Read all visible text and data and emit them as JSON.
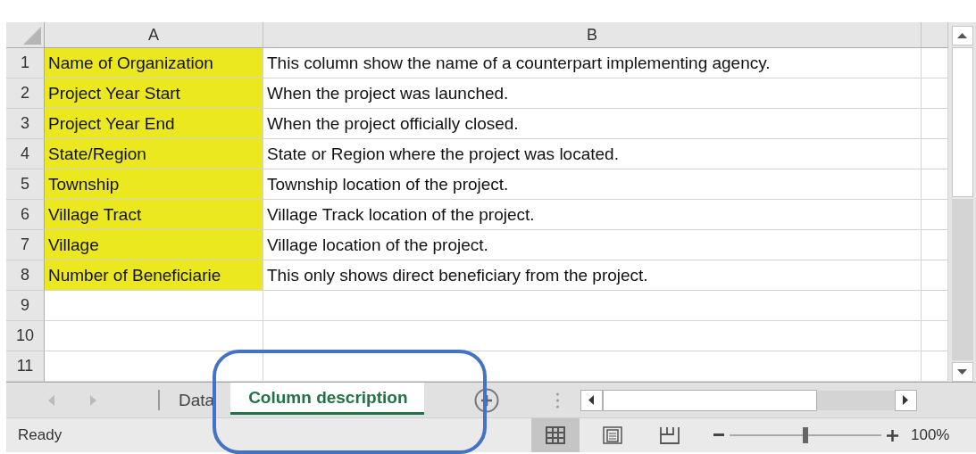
{
  "sheet": {
    "columns": [
      "A",
      "B"
    ],
    "rows": [
      {
        "number": "1",
        "a": "Name of Organization",
        "b": "This column show the name of a counterpart implementing agency.",
        "highlighted": true
      },
      {
        "number": "2",
        "a": "Project Year Start",
        "b": "When the project was launched.",
        "highlighted": true
      },
      {
        "number": "3",
        "a": "Project Year End",
        "b": "When the project officially closed.",
        "highlighted": true
      },
      {
        "number": "4",
        "a": "State/Region",
        "b": "State or Region where the project was located.",
        "highlighted": true
      },
      {
        "number": "5",
        "a": "Township",
        "b": "Township location of the project.",
        "highlighted": true
      },
      {
        "number": "6",
        "a": "Village Tract",
        "b": "Village Track location of the project.",
        "highlighted": true
      },
      {
        "number": "7",
        "a": "Village",
        "b": "Village location of the project.",
        "highlighted": true
      },
      {
        "number": "8",
        "a": "Number of Beneficiarie",
        "b": "This only shows direct beneficiary from the project.",
        "highlighted": true
      },
      {
        "number": "9",
        "highlighted": false
      },
      {
        "number": "10",
        "highlighted": false
      },
      {
        "number": "11",
        "highlighted": false
      }
    ]
  },
  "sheet_tabs": [
    {
      "label": "Data",
      "selected": false
    },
    {
      "label": "Column description",
      "selected": true
    }
  ],
  "status_bar": {
    "status": "Ready",
    "views": [
      {
        "kind": "normal",
        "selected": true
      },
      {
        "kind": "page-layout",
        "selected": false
      },
      {
        "kind": "page-break",
        "selected": false
      }
    ],
    "zoom": {
      "level": 0.5,
      "reading": "100%"
    }
  }
}
